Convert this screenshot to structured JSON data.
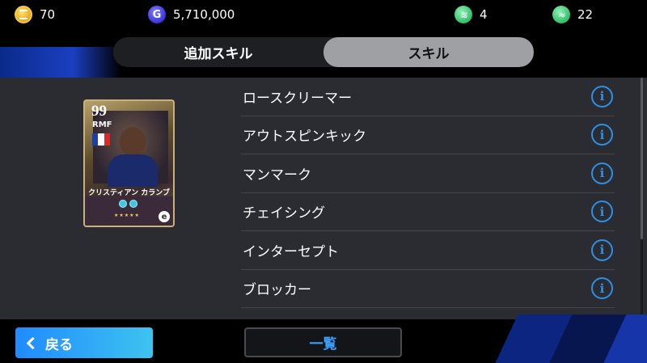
{
  "currencies": [
    {
      "icon": "coin-icon",
      "value": "70"
    },
    {
      "icon": "gp-icon",
      "icon_letter": "G",
      "value": "5,710,000"
    },
    {
      "icon": "exchange-ticket-icon",
      "value": "4"
    },
    {
      "icon": "training-ticket-icon",
      "value": "22"
    }
  ],
  "tabs": [
    {
      "label": "追加スキル",
      "active": false
    },
    {
      "label": "スキル",
      "active": true
    }
  ],
  "player_card": {
    "rating": "99",
    "position": "RMF",
    "name": "クリスティアン カランブー",
    "flag_colors": [
      "#1f3fa8",
      "#ffffff",
      "#d62b2b"
    ],
    "stars": "★★★★★"
  },
  "skills": [
    {
      "label": "ロースクリーマー"
    },
    {
      "label": "アウトスピンキック"
    },
    {
      "label": "マンマーク"
    },
    {
      "label": "チェイシング"
    },
    {
      "label": "インターセプト"
    },
    {
      "label": "ブロッカー"
    }
  ],
  "info_icon_glyph": "i",
  "buttons": {
    "back_label": "戻る",
    "list_label": "一覧"
  },
  "colors": {
    "accent_blue": "#2d8fe6",
    "panel_bg": "#2b2c31",
    "active_tab": "#9fa0a4"
  }
}
